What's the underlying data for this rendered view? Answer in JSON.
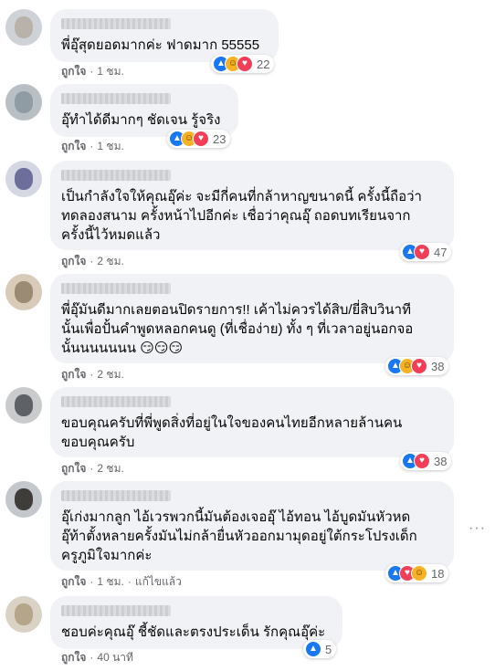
{
  "comments": [
    {
      "text": "พี่อุ๊สุดยอดมากค่ะ ฟาดมาก 55555",
      "reactions": [
        "like",
        "haha",
        "love"
      ],
      "count": "22",
      "like_label": "ถูกใจ",
      "time": "1 ชม.",
      "colors": [
        "#cfd3d8",
        "#b9b2ab"
      ]
    },
    {
      "text": "อุ๊ทำได้ดีมากๆ ชัดเจน รู้จริง",
      "reactions": [
        "like",
        "haha",
        "love"
      ],
      "count": "23",
      "like_label": "ถูกใจ",
      "time": "1 ชม.",
      "colors": [
        "#b8bfc5",
        "#8f9ca3"
      ]
    },
    {
      "text": "เป็นกำลังใจให้คุณอุ๊ค่ะ จะมีกี่คนที่กล้าหาญขนาดนี้ ครั้งนี้ถือว่า\nทดลองสนาม ครั้งหน้าไปอีกค่ะ เชื่อว่าคุณอุ๊ ถอดบทเรียนจาก\nครั้งนี้ไว้หมดแล้ว",
      "reactions": [
        "like",
        "love"
      ],
      "count": "47",
      "like_label": "ถูกใจ",
      "time": "2 ชม.",
      "colors": [
        "#d5d8e2",
        "#6d6f9a"
      ]
    },
    {
      "text": "พี่อุ๊มันดีมากเลยตอนปิดรายการ!! เค้าไม่ควรได้สิบ/ยี่สิบวินาที\nนั้นเพื่อปั้นคำพูดหลอกคนดู (ที่เชื่อง่าย) ทั้ง ๆ ที่เวลาอยู่นอกจอ\nนั้นนนนนนน 😏😏😏",
      "reactions": [
        "like",
        "haha",
        "love"
      ],
      "count": "38",
      "like_label": "ถูกใจ",
      "time": "2 ชม.",
      "colors": [
        "#d8cbb7",
        "#9b8a74"
      ]
    },
    {
      "text": "ขอบคุณครับที่พี่พูดสิ่งที่อยู่ในใจของคนไทยอีกหลายล้านคน\nขอบคุณครับ",
      "reactions": [
        "like",
        "love"
      ],
      "count": "38",
      "like_label": "ถูกใจ",
      "time": "2 ชม.",
      "colors": [
        "#c9cbcd",
        "#5e6165"
      ]
    },
    {
      "text": "อุ๊เก่งมากลูก ไอ้เวรพวกนี้มันต้องเจออุ๊ ไอ้ทอน ไอ้บูดมันหัวหด\nอุ๊ท้าตั้งหลายครั้งมันไม่กล้ายื่นหัวออกมามุดอยู่ใต้กระโปรงเด็ก\nครูภูมิใจมากค่ะ",
      "reactions": [
        "like",
        "love",
        "haha"
      ],
      "count": "18",
      "like_label": "ถูกใจ",
      "time": "1 ชม.",
      "edited": "แก้ไขแล้ว",
      "colors": [
        "#c4c8cc",
        "#3f3d3a"
      ]
    },
    {
      "text": "ชอบค่ะคุณอุ๊ ชี้ชัดและตรงประเด็น รักคุณอุ๊ค่ะ",
      "reactions": [
        "like"
      ],
      "count": "5",
      "like_label": "ถูกใจ",
      "time": "40 นาที",
      "colors": [
        "#d9d2c5",
        "#b5a58b"
      ]
    }
  ],
  "more_options": "···"
}
